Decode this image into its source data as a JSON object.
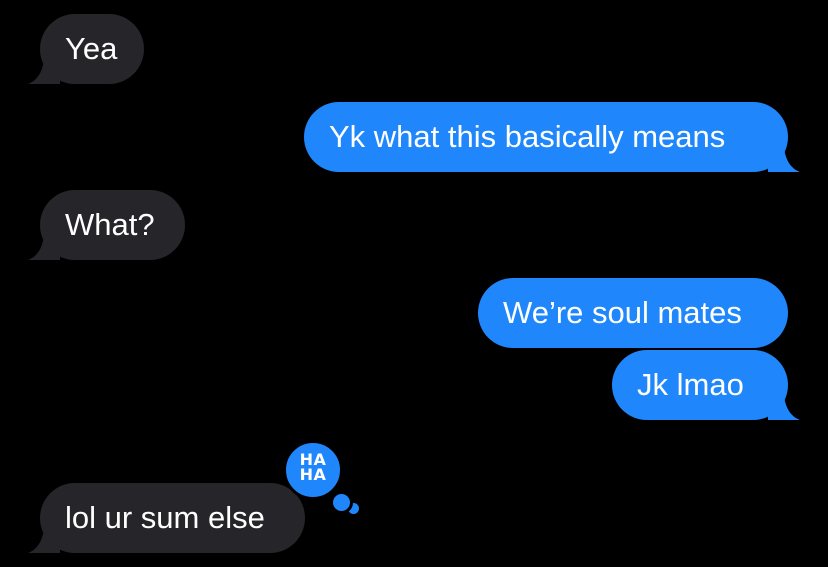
{
  "messages": [
    {
      "text": "Yea",
      "direction": "incoming"
    },
    {
      "text": "Yk what this basically means",
      "direction": "outgoing"
    },
    {
      "text": "What?",
      "direction": "incoming"
    },
    {
      "text": "We’re soul mates",
      "direction": "outgoing"
    },
    {
      "text": "Jk lmao",
      "direction": "outgoing"
    },
    {
      "text": "lol ur sum else",
      "direction": "incoming",
      "reaction": "haha"
    }
  ],
  "reaction": {
    "icon": "haha-reaction-icon",
    "line1": "HA",
    "line2": "HA"
  },
  "colors": {
    "background": "#000000",
    "incoming_bubble": "#26252a",
    "outgoing_bubble": "#1f87fb",
    "text": "#ffffff"
  }
}
